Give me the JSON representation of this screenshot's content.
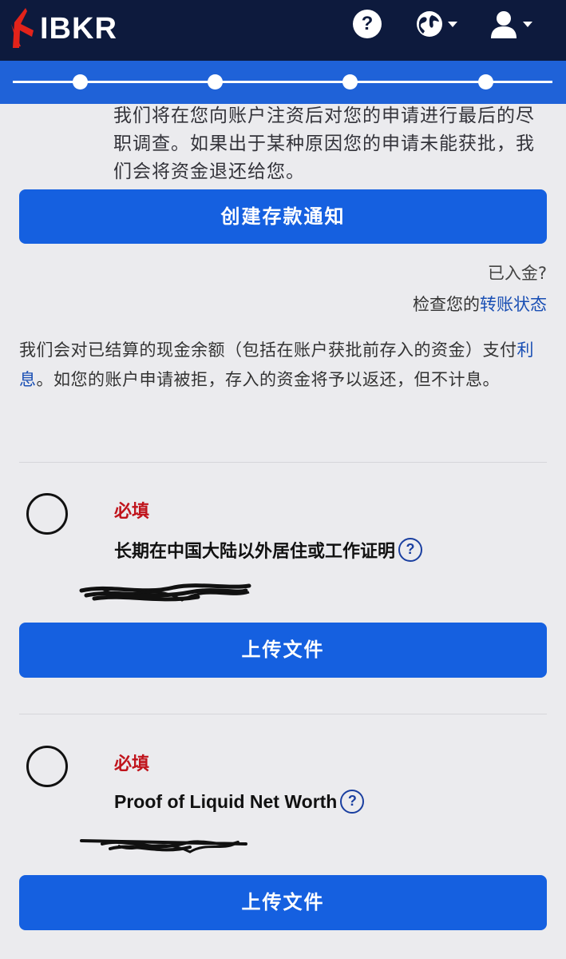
{
  "header": {
    "brand": "IBKR",
    "help_glyph": "?",
    "icons": [
      "ibkr-logo-icon",
      "help-icon",
      "globe-icon",
      "user-icon",
      "chevron-down-icon"
    ],
    "brand_color": "#0d1a3d",
    "accent_color": "#1f62d8"
  },
  "progress": {
    "steps": 4
  },
  "intro_text": "我们将在您向账户注资后对您的申请进行最后的尽职调查。如果出于某种原因您的申请未能获批，我们会将资金退还给您。",
  "deposit_button": "创建存款通知",
  "funded": {
    "question": "已入金?",
    "check_prefix": "检查您的",
    "check_link": "转账状态"
  },
  "interest": {
    "before_link": "我们会对已结算的现金余额（包括在账户获批前存入的资金）支付",
    "link": "利息",
    "after_link": "。如您的账户申请被拒，存入的资金将予以返还，但不计息。"
  },
  "tasks": [
    {
      "required_label": "必填",
      "title": "长期在中国大陆以外居住或工作证明",
      "help_glyph": "?",
      "upload_label": "上传文件"
    },
    {
      "required_label": "必填",
      "title": "Proof of Liquid Net Worth",
      "help_glyph": "?",
      "upload_label": "上传文件"
    }
  ],
  "colors": {
    "required": "#c0141c",
    "button": "#1560e0",
    "link": "#1a4fb4",
    "background": "#ebebee"
  }
}
